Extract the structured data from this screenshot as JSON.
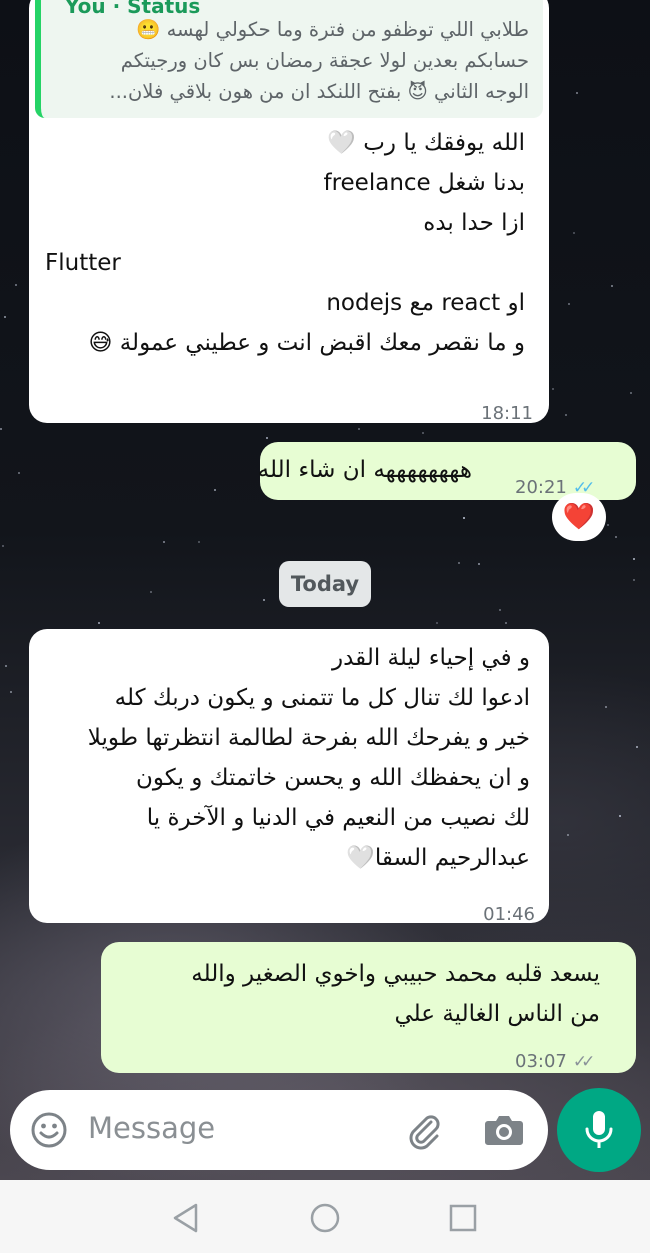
{
  "colors": {
    "accent": "#00a884",
    "incoming_bubble": "#ffffff",
    "outgoing_bubble": "#e7fdd3",
    "read_ticks": "#53bdeb"
  },
  "quoted": {
    "header": "You · Status",
    "lines": [
      "طلابي اللي توظفو من فترة وما حكولي لهسه 😬",
      "حسابكم بعدين لولا عجقة رمضان بس كان ورجيتكم",
      "الوجه الثاني 😈 بفتح اللنكد ان من هون بلاقي فلان..."
    ]
  },
  "messages": [
    {
      "lines": [
        "الله يوفقك يا رب 🤍",
        "بدنا شغل freelance",
        "ازا حدا بده",
        "Flutter",
        "او react مع nodejs",
        "و ما نقصر معك اقبض انت و عطيني عمولة 😅"
      ],
      "time": "18:11"
    },
    {
      "lines": [
        "ههههههههه ان شاء الله"
      ],
      "time": "20:21",
      "reaction": "❤️"
    },
    {
      "lines": [
        "و في إحياء ليلة القدر",
        "ادعوا لك تنال كل ما تتمنى و يكون دربك كله",
        "خير و يفرحك الله بفرحة لطالمة انتظرتها طويلا",
        "و ان يحفظك الله و يحسن خاتمتك و يكون",
        "لك نصيب من النعيم في الدنيا و الآخرة  يا",
        "عبدالرحيم السقا🤍"
      ],
      "time": "01:46"
    },
    {
      "lines": [
        "يسعد قلبه محمد حبيبي واخوي الصغير والله",
        "من الناس الغالية علي"
      ],
      "time": "03:07"
    }
  ],
  "date_divider": "Today",
  "composer": {
    "placeholder": "Message",
    "icons": [
      "emoji-icon",
      "attach-icon",
      "camera-icon",
      "mic-icon"
    ]
  },
  "nav_icons": [
    "back-icon",
    "home-icon",
    "recents-icon"
  ]
}
